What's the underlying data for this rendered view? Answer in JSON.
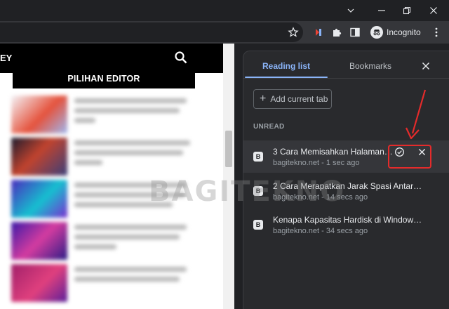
{
  "window": {
    "controls": [
      "chevron-down-icon",
      "minimize-icon",
      "restore-icon",
      "close-icon"
    ]
  },
  "toolbar": {
    "profile_label": "Incognito"
  },
  "page": {
    "brand_fragment": "EY",
    "editor_pick_label": "PILIHAN EDITOR",
    "watermark": "BAGITEKNO"
  },
  "side_panel": {
    "tabs": [
      {
        "label": "Reading list",
        "active": true
      },
      {
        "label": "Bookmarks",
        "active": false
      }
    ],
    "add_current_tab_label": "Add current tab",
    "section_label": "UNREAD",
    "items": [
      {
        "title": "3 Cara Memisahkan Halaman ...",
        "meta": "bagitekno.net - 1 sec ago"
      },
      {
        "title": "2 Cara Merapatkan Jarak Spasi Antar Ite...",
        "meta": "bagitekno.net - 14 secs ago"
      },
      {
        "title": "Kenapa Kapasitas Hardisk di Windows Ti...",
        "meta": "bagitekno.net - 34 secs ago"
      }
    ]
  },
  "colors": {
    "accent": "#8ab4f8",
    "highlight": "#e52b2b",
    "panel_bg": "#292a2d"
  }
}
